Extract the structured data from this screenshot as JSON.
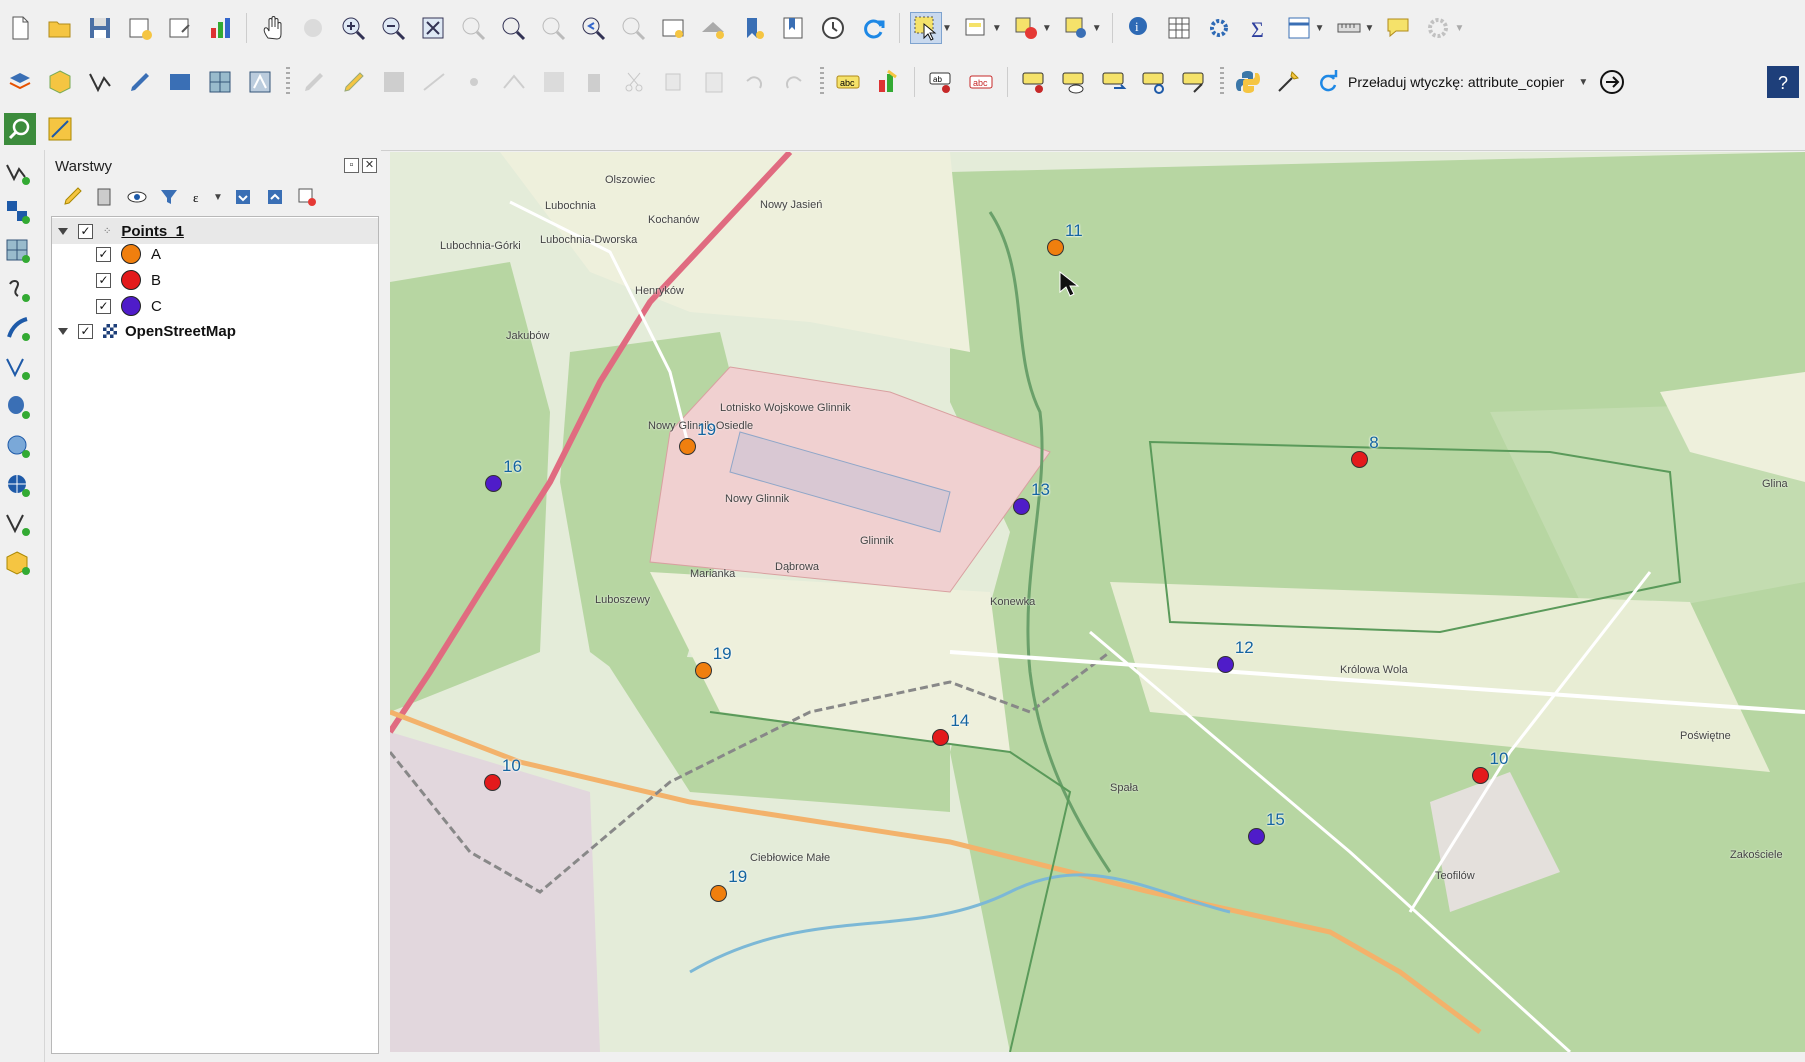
{
  "toolbar": {
    "reload_plugin_label": "Przeładuj wtyczkę: attribute_copier",
    "row1_icons": [
      "new-project-icon",
      "open-project-icon",
      "save-project-icon",
      "new-print-layout-icon",
      "layout-manager-icon",
      "style-manager-icon",
      "pan-icon",
      "pan-to-selection-icon",
      "zoom-in-icon",
      "zoom-out-icon",
      "zoom-full-icon",
      "zoom-to-selection-icon",
      "zoom-to-layer-icon",
      "zoom-native-icon",
      "zoom-last-icon",
      "zoom-next-icon",
      "new-map-view-icon",
      "new-3d-map-view-icon",
      "new-bookmark-icon",
      "show-bookmarks-icon",
      "temporal-controller-icon",
      "refresh-icon",
      "select-features-icon",
      "select-by-value-icon",
      "deselect-icon",
      "select-by-location-icon",
      "identify-icon",
      "attribute-table-icon",
      "processing-toolbox-icon",
      "statistics-icon",
      "field-calculator-icon",
      "measure-icon",
      "map-tips-icon",
      "settings-icon"
    ],
    "row2_icons": [
      "data-source-manager-icon",
      "new-geopackage-layer-icon",
      "digitize-icon",
      "edit-pencil-icon",
      "raster-icon",
      "mesh-icon",
      "vertex-tool-icon"
    ],
    "label_tool_icons": [
      "label-abc-icon",
      "diagram-icon",
      "pin-label-icon",
      "highlight-label-icon",
      "move-label-icon",
      "show-hide-label-icon",
      "rotate-label-icon",
      "change-label-icon",
      "label-settings-icon"
    ]
  },
  "layers_panel": {
    "title": "Warstwy",
    "tree": {
      "points_layer": "Points_1",
      "categories": [
        {
          "label": "A",
          "color": "#f07f0e"
        },
        {
          "label": "B",
          "color": "#e31a1c"
        },
        {
          "label": "C",
          "color": "#4f1cc9"
        }
      ],
      "basemap_layer": "OpenStreetMap"
    }
  },
  "map": {
    "points": [
      {
        "label": "11",
        "cat": "A",
        "lon": 0.47,
        "lat": 0.105
      },
      {
        "label": "19",
        "cat": "A",
        "lon": 0.21,
        "lat": 0.327
      },
      {
        "label": "16",
        "cat": "C",
        "lon": 0.073,
        "lat": 0.368
      },
      {
        "label": "13",
        "cat": "C",
        "lon": 0.446,
        "lat": 0.393
      },
      {
        "label": "8",
        "cat": "B",
        "lon": 0.685,
        "lat": 0.341
      },
      {
        "label": "12",
        "cat": "C",
        "lon": 0.59,
        "lat": 0.569
      },
      {
        "label": "19",
        "cat": "A",
        "lon": 0.221,
        "lat": 0.575
      },
      {
        "label": "14",
        "cat": "B",
        "lon": 0.389,
        "lat": 0.65
      },
      {
        "label": "10",
        "cat": "B",
        "lon": 0.072,
        "lat": 0.7
      },
      {
        "label": "10",
        "cat": "B",
        "lon": 0.77,
        "lat": 0.692
      },
      {
        "label": "15",
        "cat": "C",
        "lon": 0.612,
        "lat": 0.76
      },
      {
        "label": "19",
        "cat": "A",
        "lon": 0.232,
        "lat": 0.823
      }
    ],
    "places": [
      {
        "name": "Olszowiec"
      },
      {
        "name": "Lubochnia"
      },
      {
        "name": "Lubochnia-Dworska"
      },
      {
        "name": "Lubochnia-Górki"
      },
      {
        "name": "Kochanów"
      },
      {
        "name": "Nowy Jasień"
      },
      {
        "name": "Henryków"
      },
      {
        "name": "Jakubów"
      },
      {
        "name": "Nowy Glinnik-Osiedle"
      },
      {
        "name": "Lotnisko Wojskowe Glinnik"
      },
      {
        "name": "Nowy Glinnik"
      },
      {
        "name": "Glinnik"
      },
      {
        "name": "Marianka"
      },
      {
        "name": "Dąbrowa"
      },
      {
        "name": "Luboszewy"
      },
      {
        "name": "Konewka"
      },
      {
        "name": "Królowa Wola"
      },
      {
        "name": "Poświętne"
      },
      {
        "name": "Glina"
      },
      {
        "name": "Spała"
      },
      {
        "name": "Ciebłowice Małe"
      },
      {
        "name": "Teofilów"
      },
      {
        "name": "Zakościele"
      }
    ]
  }
}
